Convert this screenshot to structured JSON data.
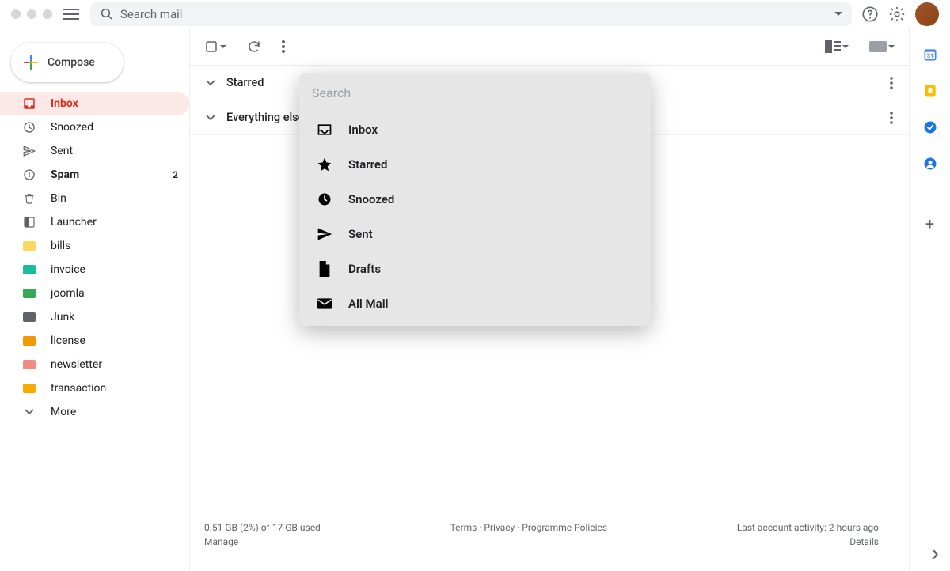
{
  "header": {
    "search_placeholder": "Search mail"
  },
  "sidebar": {
    "compose_label": "Compose",
    "items": [
      {
        "label": "Inbox",
        "icon": "inbox"
      },
      {
        "label": "Snoozed",
        "icon": "clock"
      },
      {
        "label": "Sent",
        "icon": "send"
      },
      {
        "label": "Spam",
        "icon": "spam",
        "count": "2"
      },
      {
        "label": "Bin",
        "icon": "trash"
      },
      {
        "label": "Launcher",
        "icon": "launcher"
      }
    ],
    "labels": [
      {
        "label": "bills",
        "color": "yellow"
      },
      {
        "label": "invoice",
        "color": "teal"
      },
      {
        "label": "joomla",
        "color": "green"
      },
      {
        "label": "Junk",
        "color": "dark"
      },
      {
        "label": "license",
        "color": "orange"
      },
      {
        "label": "newsletter",
        "color": "pink"
      },
      {
        "label": "transaction",
        "color": "amber"
      }
    ],
    "more_label": "More"
  },
  "sections": {
    "starred": "Starred",
    "everything_else": "Everything else"
  },
  "dropdown": {
    "search_placeholder": "Search",
    "items": [
      {
        "label": "Inbox",
        "icon": "inbox"
      },
      {
        "label": "Starred",
        "icon": "star"
      },
      {
        "label": "Snoozed",
        "icon": "clock-filled"
      },
      {
        "label": "Sent",
        "icon": "send-filled"
      },
      {
        "label": "Drafts",
        "icon": "file"
      },
      {
        "label": "All Mail",
        "icon": "mail"
      }
    ]
  },
  "footer": {
    "storage_line": "0.51 GB (2%) of 17 GB used",
    "manage": "Manage",
    "terms": "Terms",
    "privacy": "Privacy",
    "policies": "Programme Policies",
    "activity": "Last account activity: 2 hours ago",
    "details": "Details"
  }
}
